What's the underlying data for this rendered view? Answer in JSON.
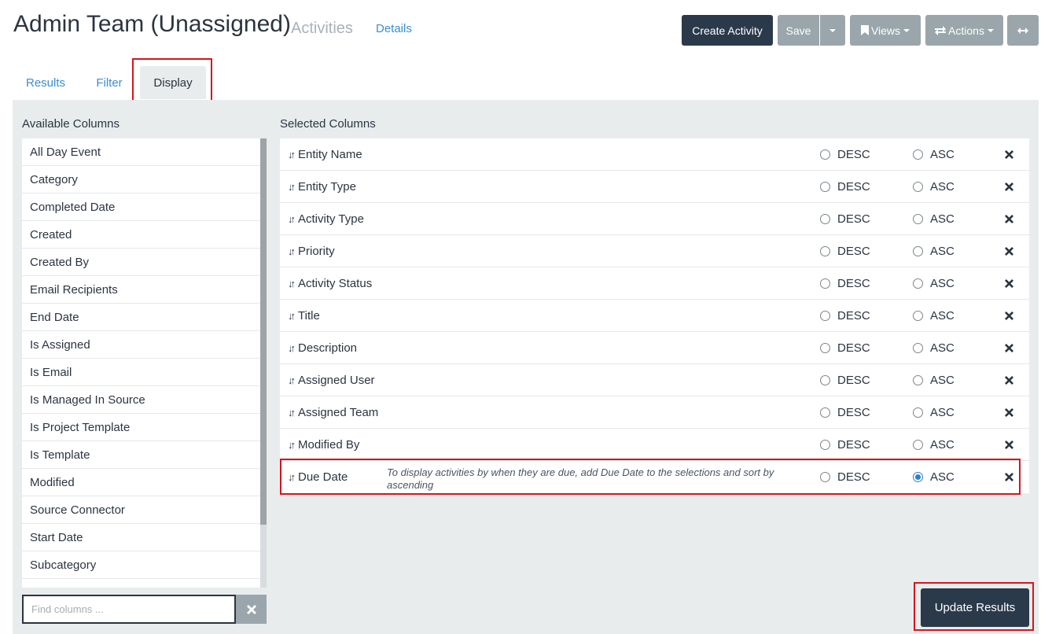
{
  "header": {
    "title": "Admin Team (Unassigned)",
    "subtitle": "Activities",
    "details_link": "Details"
  },
  "toolbar": {
    "create_activity": "Create Activity",
    "save": "Save",
    "views": "Views",
    "actions": "Actions"
  },
  "tabs": [
    {
      "label": "Results",
      "active": false
    },
    {
      "label": "Filter",
      "active": false
    },
    {
      "label": "Display",
      "active": true
    }
  ],
  "available": {
    "heading": "Available Columns",
    "items": [
      "All Day Event",
      "Category",
      "Completed Date",
      "Created",
      "Created By",
      "Email Recipients",
      "End Date",
      "Is Assigned",
      "Is Email",
      "Is Managed In Source",
      "Is Project Template",
      "Is Template",
      "Modified",
      "Source Connector",
      "Start Date",
      "Subcategory"
    ],
    "search_placeholder": "Find columns ..."
  },
  "selected": {
    "heading": "Selected Columns",
    "desc_label": "DESC",
    "asc_label": "ASC",
    "rows": [
      {
        "name": "Entity Name",
        "sort": "none"
      },
      {
        "name": "Entity Type",
        "sort": "none"
      },
      {
        "name": "Activity Type",
        "sort": "none"
      },
      {
        "name": "Priority",
        "sort": "none"
      },
      {
        "name": "Activity Status",
        "sort": "none"
      },
      {
        "name": "Title",
        "sort": "none"
      },
      {
        "name": "Description",
        "sort": "none"
      },
      {
        "name": "Assigned User",
        "sort": "none"
      },
      {
        "name": "Assigned Team",
        "sort": "none"
      },
      {
        "name": "Modified By",
        "sort": "none"
      },
      {
        "name": "Due Date",
        "sort": "asc",
        "hint": "To display activities by when they are due, add Due Date to the selections and sort by ascending"
      }
    ]
  },
  "footer": {
    "update_results": "Update Results"
  },
  "colors": {
    "accent_blue": "#3b8ed4",
    "dark_button": "#2b3a4a",
    "gray_button": "#9aa6ab",
    "highlight_red": "#d4161c",
    "panel_bg": "#e9eced"
  }
}
